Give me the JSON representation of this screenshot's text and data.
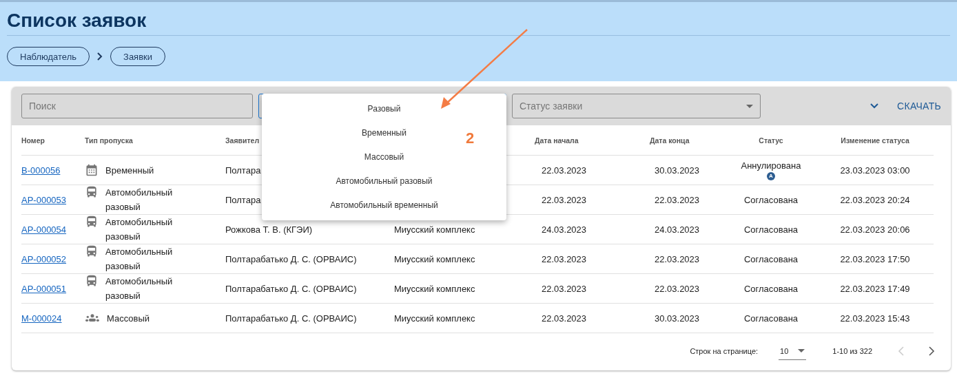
{
  "page": {
    "title": "Список заявок"
  },
  "breadcrumbs": [
    {
      "label": "Наблюдатель"
    },
    {
      "label": "Заявки"
    }
  ],
  "filters": {
    "search": {
      "placeholder": "Поиск"
    },
    "status": {
      "placeholder": "Статус заявки"
    },
    "download": "СКАЧАТЬ"
  },
  "dropdown_menu": {
    "items": [
      {
        "label": "Разовый"
      },
      {
        "label": "Временный"
      },
      {
        "label": "Массовый"
      },
      {
        "label": "Автомобильный разовый"
      },
      {
        "label": "Автомобильный временный"
      }
    ]
  },
  "annotation": {
    "label": "2"
  },
  "table": {
    "columns": {
      "number": "Номер",
      "type": "Тип пропуска",
      "applicant": "Заявител",
      "start": "Дата начала",
      "end": "Дата конца",
      "status": "Статус",
      "changed": "Изменение статуса"
    },
    "rows": [
      {
        "number": "В-000056",
        "kind": "calendar",
        "type": "Временный",
        "applicant": "Полтара",
        "start": "22.03.2023",
        "end": "30.03.2023",
        "status": "Аннулирована",
        "badge": "A",
        "changed": "23.03.2023 03:00"
      },
      {
        "number": "АР-000053",
        "kind": "bus",
        "type": "Автомобильный разовый",
        "applicant": "Полтара",
        "start": "22.03.2023",
        "end": "22.03.2023",
        "status": "Согласована",
        "changed": "22.03.2023 20:24"
      },
      {
        "number": "АР-000054",
        "kind": "bus",
        "type": "Автомобильный разовый",
        "applicant": "Рожкова Т. В. (КГЭИ)",
        "column_4": "Миусский комплекс",
        "start": "24.03.2023",
        "end": "24.03.2023",
        "status": "Согласована",
        "changed": "22.03.2023 20:06"
      },
      {
        "number": "АР-000052",
        "kind": "bus",
        "type": "Автомобильный разовый",
        "applicant": "Полтарабатько Д. С. (ОРВАИС)",
        "column_4": "Миусский комплекс",
        "start": "22.03.2023",
        "end": "22.03.2023",
        "status": "Согласована",
        "changed": "22.03.2023 17:50"
      },
      {
        "number": "АР-000051",
        "kind": "bus",
        "type": "Автомобильный разовый",
        "applicant": "Полтарабатько Д. С. (ОРВАИС)",
        "column_4": "Миусский комплекс",
        "start": "22.03.2023",
        "end": "22.03.2023",
        "status": "Согласована",
        "changed": "22.03.2023 17:49"
      },
      {
        "number": "М-000024",
        "kind": "people",
        "type": "Массовый",
        "applicant": "Полтарабатько Д. С. (ОРВАИС)",
        "column_4": "Миусский комплекс",
        "start": "22.03.2023",
        "end": "30.03.2023",
        "status": "Согласована",
        "changed": "22.03.2023 15:43"
      }
    ]
  },
  "pagination": {
    "rows_label": "Строк на странице:",
    "rows_per_page": "10",
    "range": "1-10 из 322"
  }
}
